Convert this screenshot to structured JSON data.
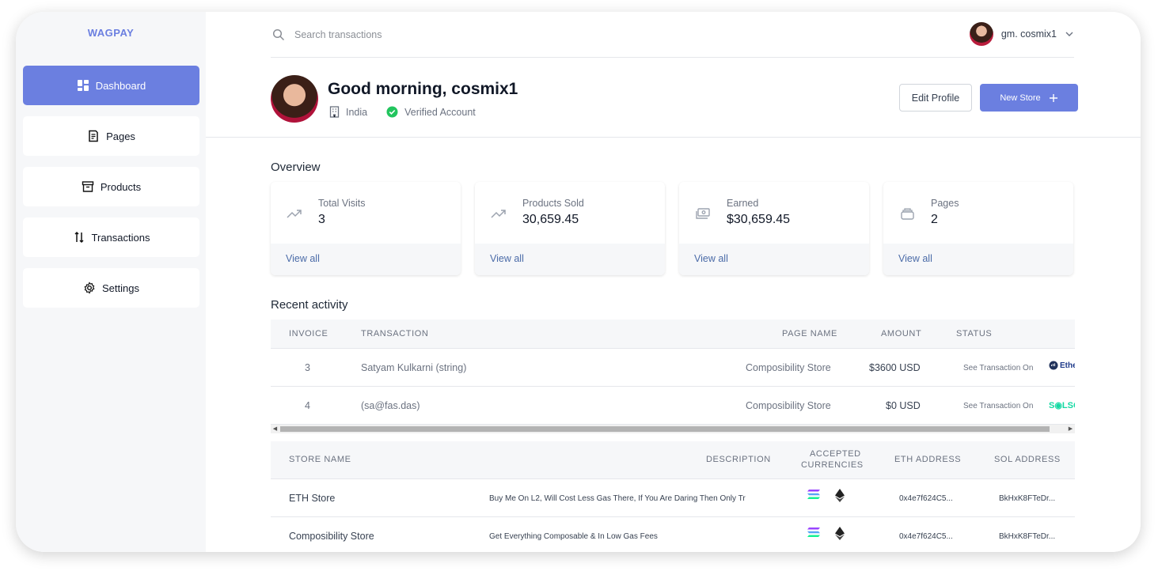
{
  "brand": "WAGPAY",
  "colors": {
    "accent": "#6b7fe0",
    "link": "#4b6ba8",
    "verified": "#22c55e"
  },
  "sidebar": {
    "items": [
      {
        "label": "Dashboard",
        "icon": "dashboard-icon",
        "active": true
      },
      {
        "label": "Pages",
        "icon": "pages-icon",
        "active": false
      },
      {
        "label": "Products",
        "icon": "archive-icon",
        "active": false
      },
      {
        "label": "Transactions",
        "icon": "arrows-updown-icon",
        "active": false
      },
      {
        "label": "Settings",
        "icon": "gear-icon",
        "active": false
      }
    ]
  },
  "search": {
    "placeholder": "Search transactions",
    "value": ""
  },
  "user": {
    "name": "gm. cosmix1"
  },
  "header": {
    "greeting": "Good morning, cosmix1",
    "location": "India",
    "verified": "Verified Account",
    "edit_label": "Edit Profile",
    "new_store_label": "New Store"
  },
  "overview": {
    "title": "Overview",
    "cards": [
      {
        "label": "Total Visits",
        "value": "3",
        "link": "View all",
        "icon": "trend-up-icon"
      },
      {
        "label": "Products Sold",
        "value": "30,659.45",
        "link": "View all",
        "icon": "trend-up-icon"
      },
      {
        "label": "Earned",
        "value": "$30,659.45",
        "link": "View all",
        "icon": "cash-icon"
      },
      {
        "label": "Pages",
        "value": "2",
        "link": "View all",
        "icon": "stack-icon"
      }
    ]
  },
  "activity": {
    "title": "Recent activity",
    "columns": [
      "INVOICE",
      "TRANSACTION",
      "PAGE NAME",
      "AMOUNT",
      "STATUS"
    ],
    "rows": [
      {
        "invoice": "3",
        "transaction": "Satyam Kulkarni (string)",
        "page": "Composibility Store",
        "amount": "$3600 USD",
        "status": "See Transaction On",
        "explorer": "Ether"
      },
      {
        "invoice": "4",
        "transaction": "(sa@fas.das)",
        "page": "Composibility Store",
        "amount": "$0 USD",
        "status": "See Transaction On",
        "explorer": "S◉LSC"
      }
    ]
  },
  "stores": {
    "columns": [
      "STORE NAME",
      "DESCRIPTION",
      "ACCEPTED",
      "CURRENCIES",
      "ETH ADDRESS",
      "SOL ADDRESS"
    ],
    "rows": [
      {
        "name": "ETH Store",
        "description": "Buy Me On L2, Will Cost Less Gas There, If You Are Daring Then Only Tr",
        "eth": "0x4e7f624C5...",
        "sol": "BkHxK8FTeDr..."
      },
      {
        "name": "Composibility Store",
        "description": "Get Everything Composable & In Low Gas Fees",
        "eth": "0x4e7f624C5...",
        "sol": "BkHxK8FTeDr..."
      }
    ]
  }
}
